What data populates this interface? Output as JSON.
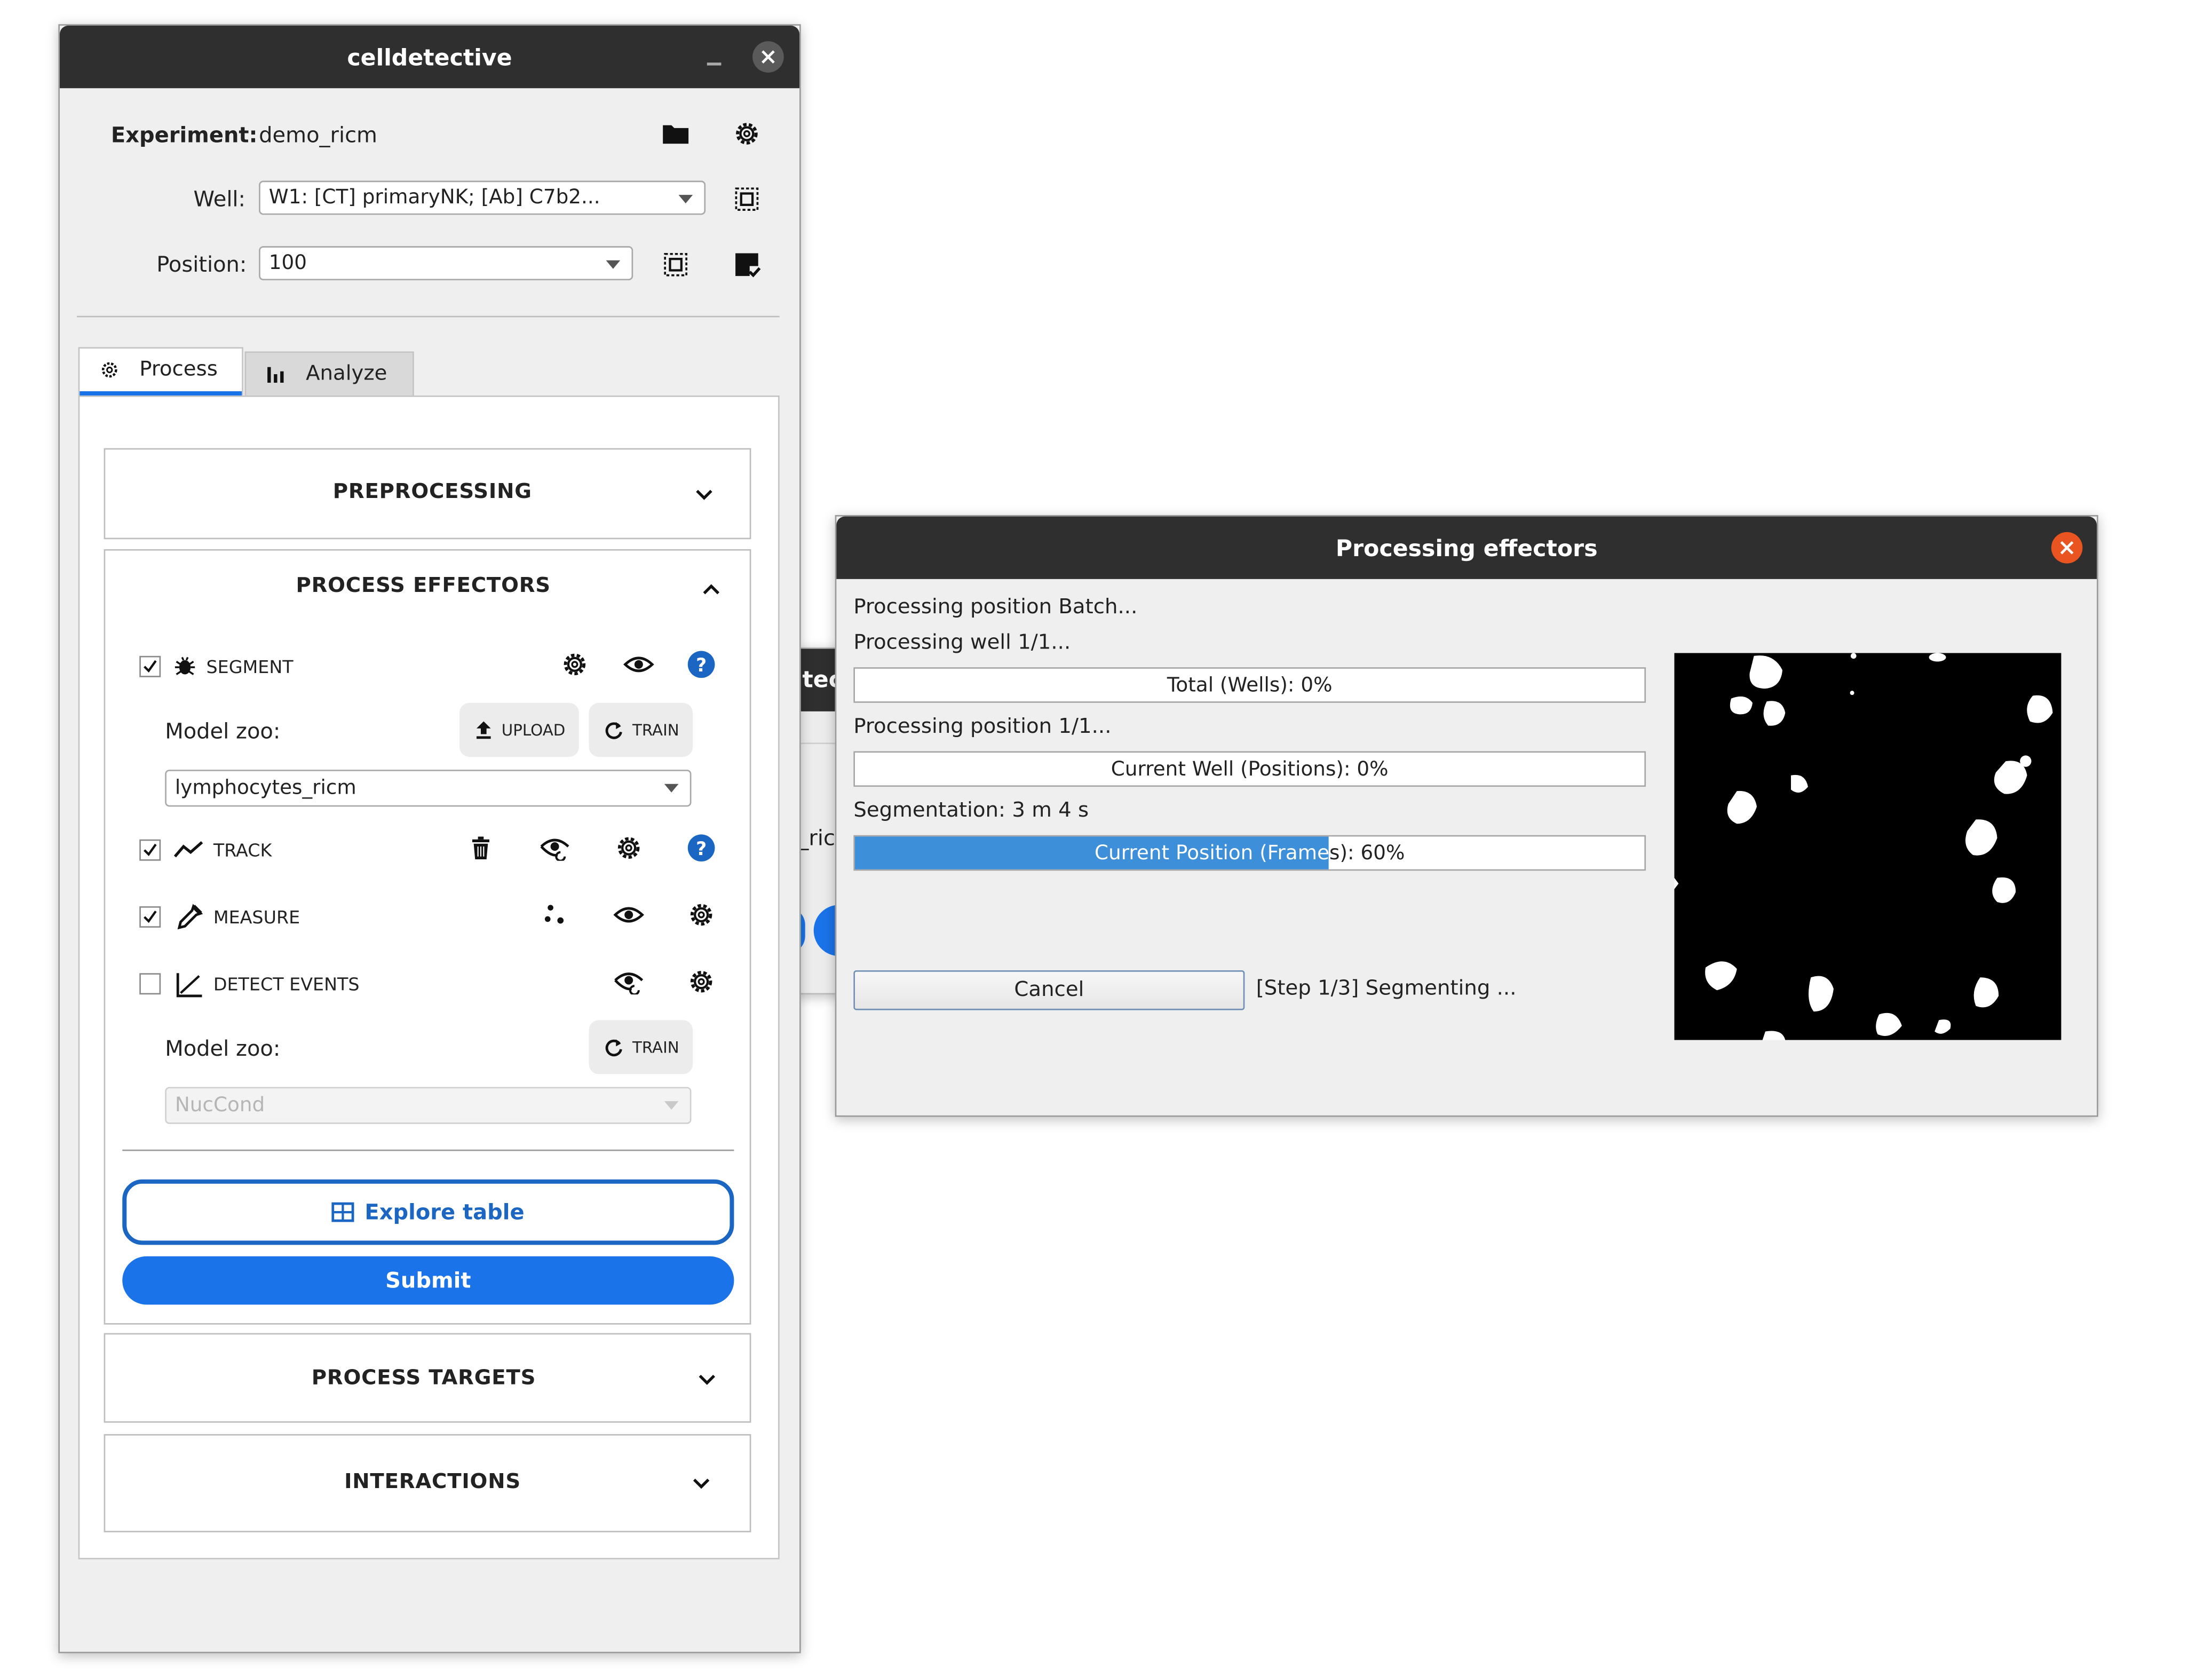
{
  "main_window": {
    "title": "celldetective",
    "experiment_label": "Experiment:",
    "experiment_value": "demo_ricm",
    "well_label": "Well:",
    "well_value": "W1: [CT] primaryNK; [Ab] C7b2...",
    "position_label": "Position:",
    "position_value": "100",
    "tabs": [
      {
        "label": "Process",
        "icon": "gear-icon",
        "active": true
      },
      {
        "label": "Analyze",
        "icon": "bar-chart-icon",
        "active": false
      }
    ],
    "sections": {
      "preprocessing": "PREPROCESSING",
      "process_effectors": "PROCESS EFFECTORS",
      "process_targets": "PROCESS TARGETS",
      "interactions": "INTERACTIONS"
    },
    "steps": {
      "segment": {
        "label": "SEGMENT",
        "checked": true
      },
      "track": {
        "label": "TRACK",
        "checked": true
      },
      "measure": {
        "label": "MEASURE",
        "checked": true
      },
      "detect_events": {
        "label": "DETECT EVENTS",
        "checked": false
      }
    },
    "model_zoo_label": "Model zoo:",
    "upload_label": "UPLOAD",
    "train_label": "TRAIN",
    "segment_model": "lymphocytes_ricm",
    "events_model": "NucCond",
    "explore_table_label": "Explore table",
    "submit_label": "Submit",
    "accent_color": "#1a73e8"
  },
  "background_window_fragments": {
    "title_fragment": "tec",
    "text_fragment": "_ric"
  },
  "progress_window": {
    "title": "Processing effectors",
    "line_batch": "Processing position Batch...",
    "line_well": "Processing well 1/1...",
    "bar_total": {
      "label": "Total (Wells): 0%",
      "percent": 0
    },
    "line_position": "Processing position 1/1...",
    "bar_well": {
      "label": "Current Well (Positions): 0%",
      "percent": 0
    },
    "segmentation_time": "Segmentation: 3 m 4 s",
    "bar_position": {
      "label": "Current Position (Frames): 60%",
      "percent": 60
    },
    "cancel_label": "Cancel",
    "step_status": "[Step 1/3] Segmenting ...",
    "close_color": "#e95420",
    "fill_color": "#3d8fd9"
  }
}
